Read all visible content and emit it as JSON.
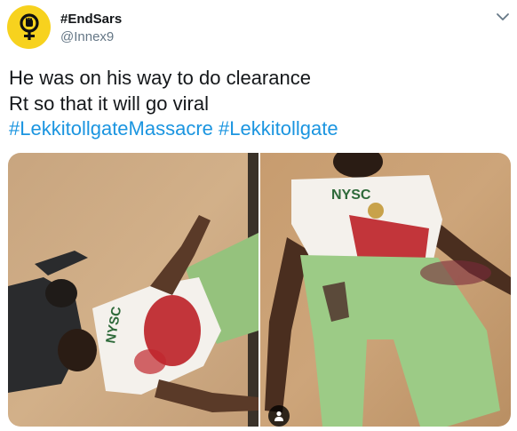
{
  "author": {
    "display_name": "#EndSars",
    "handle": "@Innex9",
    "avatar_icon": "venus-raised-fist-icon",
    "avatar_color": "#f7d21e"
  },
  "tweet": {
    "lines": [
      "He was on his way to do clearance",
      "Rt so that  it will go viral"
    ],
    "hashtags": [
      "#LekkitollgateMassacre",
      "#Lekkitollgate"
    ],
    "hashtag_color": "#1b95e0"
  },
  "media": {
    "photos": [
      {
        "shirt_text": "NYSC"
      },
      {
        "shirt_text": "NYSC"
      }
    ],
    "badge_icon": "person-tag-icon"
  },
  "menu_icon": "chevron-down-icon"
}
